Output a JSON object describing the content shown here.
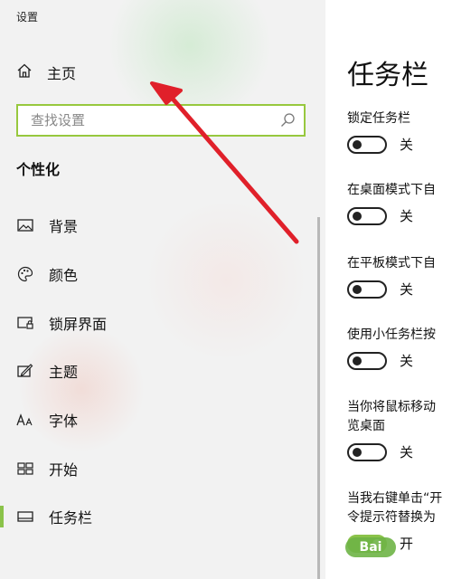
{
  "app": {
    "title": "设置"
  },
  "sidebar": {
    "home_label": "主页",
    "search": {
      "placeholder": "查找设置"
    },
    "section_title": "个性化",
    "items": [
      {
        "label": "背景",
        "icon": "picture-icon"
      },
      {
        "label": "颜色",
        "icon": "palette-icon"
      },
      {
        "label": "锁屏界面",
        "icon": "lock-screen-icon"
      },
      {
        "label": "主题",
        "icon": "theme-brush-icon"
      },
      {
        "label": "字体",
        "icon": "font-icon"
      },
      {
        "label": "开始",
        "icon": "start-grid-icon"
      },
      {
        "label": "任务栏",
        "icon": "taskbar-icon",
        "active": true
      }
    ]
  },
  "main": {
    "title": "任务栏",
    "settings": [
      {
        "label": "锁定任务栏",
        "state": "关"
      },
      {
        "label": "在桌面模式下自",
        "state": "关"
      },
      {
        "label": "在平板模式下自",
        "state": "关"
      },
      {
        "label": "使用小任务栏按",
        "state": "关"
      },
      {
        "label_lines": [
          "当你将鼠标移动",
          "览桌面"
        ],
        "state": "关"
      },
      {
        "label_lines": [
          "当我右键单击“开",
          "令提示符替换为"
        ],
        "state": "开"
      }
    ]
  },
  "watermark": {
    "text": "Bai"
  },
  "colors": {
    "accent": "#8bc34a",
    "search_border": "#97c83e",
    "arrow": "#e0202a"
  }
}
